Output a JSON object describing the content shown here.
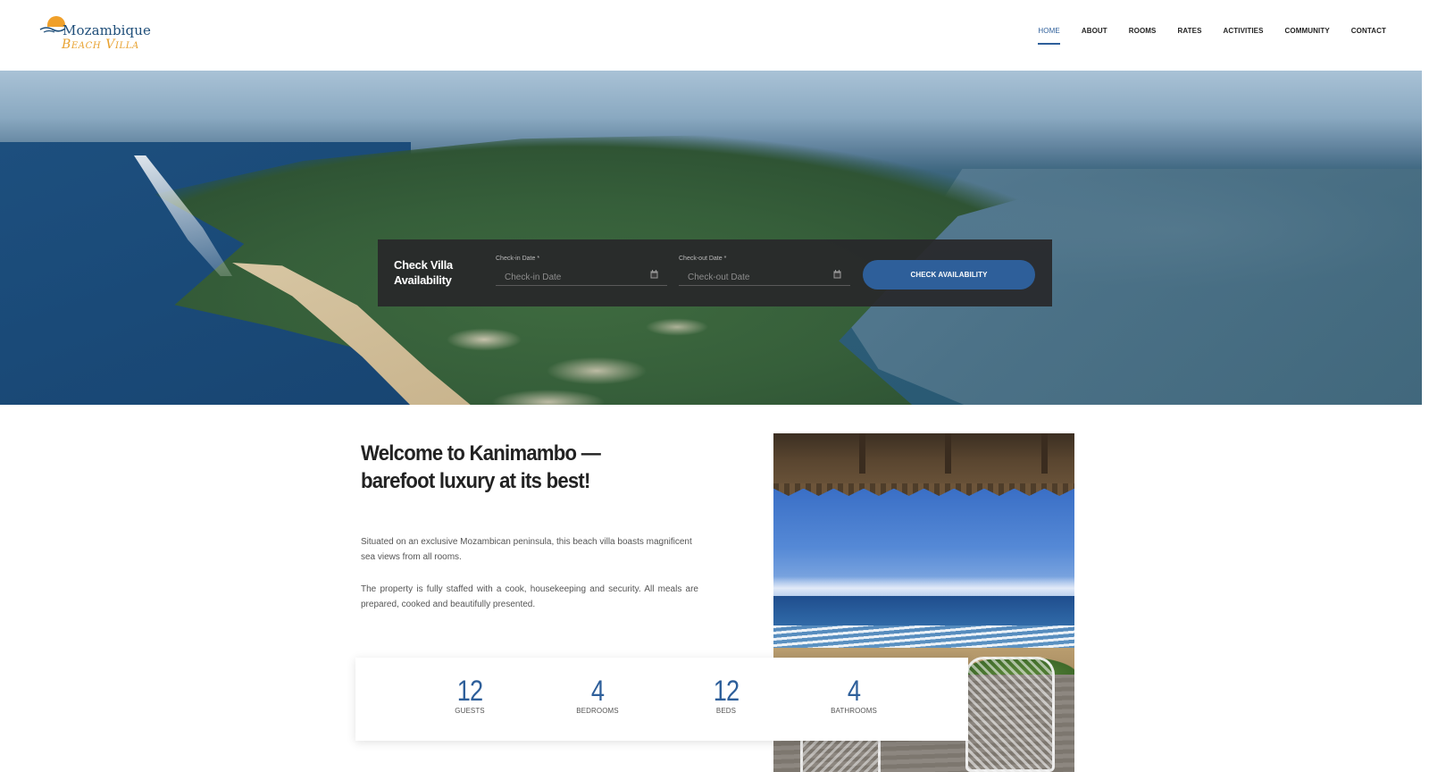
{
  "brand": {
    "logo_line1": "Mozambique",
    "logo_line2": "Beach Villa"
  },
  "nav": {
    "items": [
      {
        "label": "HOME",
        "active": true
      },
      {
        "label": "ABOUT",
        "active": false
      },
      {
        "label": "ROOMS",
        "active": false
      },
      {
        "label": "RATES",
        "active": false
      },
      {
        "label": "ACTIVITIES",
        "active": false
      },
      {
        "label": "COMMUNITY",
        "active": false
      },
      {
        "label": "CONTACT",
        "active": false
      }
    ]
  },
  "availability": {
    "title": "Check Villa Availability",
    "checkin": {
      "label": "Check-in Date",
      "required_mark": "*",
      "placeholder": "Check-in Date",
      "icon": "calendar-icon"
    },
    "checkout": {
      "label": "Check-out Date",
      "required_mark": "*",
      "placeholder": "Check-out Date",
      "icon": "calendar-icon"
    },
    "button_label": "CHECK AVAILABILITY"
  },
  "welcome": {
    "title_line1": "Welcome to Kanimambo —",
    "title_line2": "barefoot luxury at its best!",
    "paragraph1": "Situated on an exclusive Mozambican peninsula, this beach villa boasts magnificent sea views from all rooms.",
    "paragraph2": "The property is fully staffed with a cook, housekeeping and security. All meals are prepared, cooked and beautifully presented."
  },
  "stats": [
    {
      "value": "12",
      "label": "GUESTS"
    },
    {
      "value": "4",
      "label": "BEDROOMS"
    },
    {
      "value": "12",
      "label": "BEDS"
    },
    {
      "value": "4",
      "label": "BATHROOMS"
    }
  ],
  "colors": {
    "accent": "#2e5f9a",
    "logo_orange": "#e8a12e",
    "bar_bg": "#28282a"
  }
}
